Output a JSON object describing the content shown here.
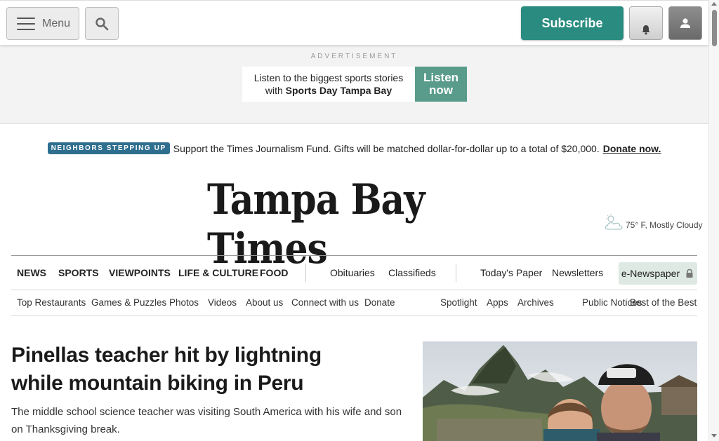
{
  "topbar": {
    "menu_label": "Menu",
    "subscribe_label": "Subscribe"
  },
  "ad": {
    "label": "ADVERTISEMENT",
    "line1": "Listen to the biggest sports stories",
    "line2_prefix": "with",
    "line2_brand": "Sports Day Tampa Bay",
    "cta_line1": "Listen",
    "cta_line2": "now"
  },
  "promo": {
    "badge": "NEIGHBORS STEPPING UP",
    "text": "Support the Times Journalism Fund. Gifts will be matched dollar-for-dollar up to a total of $20,000.",
    "link": "Donate now."
  },
  "masthead": {
    "title": "Tampa Bay Times",
    "weather": "75° F, Mostly Cloudy",
    "weather_icon": "cloudy-icon"
  },
  "nav_primary": {
    "main": [
      "NEWS",
      "SPORTS",
      "VIEWPOINTS",
      "LIFE & CULTURE",
      "FOOD"
    ],
    "secondary": [
      "Obituaries",
      "Classifieds"
    ],
    "tertiary": [
      "Today's Paper",
      "Newsletters"
    ],
    "enewspaper": "e-Newspaper"
  },
  "nav_secondary": {
    "left": [
      "Top Restaurants",
      "Games & Puzzles",
      "Photos",
      "Videos",
      "About us",
      "Connect with us",
      "Donate"
    ],
    "right": [
      "Spotlight",
      "Apps",
      "Archives",
      "Public Notices",
      "Best of the Best"
    ]
  },
  "story": {
    "headline": "Pinellas teacher hit by lightning while mountain biking in Peru",
    "summary": "The middle school science teacher was visiting South America with his wife and son on Thanksgiving break."
  },
  "colors": {
    "accent": "#2a8c80",
    "badge": "#2e6e8e",
    "enews_bg": "#dde9e2"
  }
}
